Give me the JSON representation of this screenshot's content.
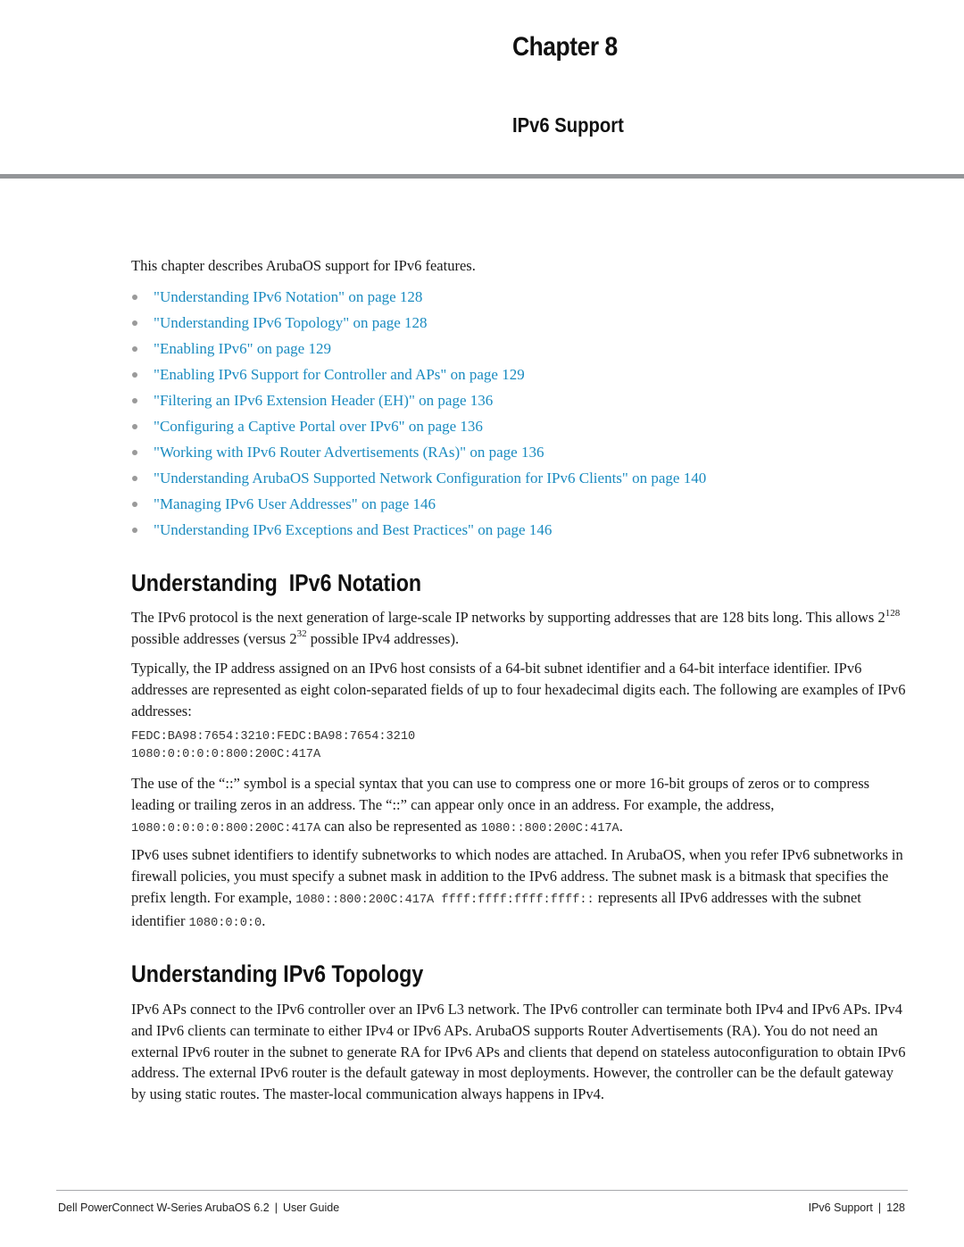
{
  "header": {
    "chapter_label": "Chapter 8",
    "chapter_title": "IPv6 Support"
  },
  "intro": "This chapter describes ArubaOS support for IPv6 features.",
  "toc": [
    {
      "label": "\"Understanding IPv6 Notation\" on page 128"
    },
    {
      "label": "\"Understanding IPv6 Topology\" on page 128"
    },
    {
      "label": "\"Enabling IPv6\" on page 129"
    },
    {
      "label": "\"Enabling IPv6 Support for Controller and APs\" on page 129"
    },
    {
      "label": "\"Filtering an IPv6 Extension Header (EH)\" on page 136"
    },
    {
      "label": "\"Configuring a Captive Portal over IPv6\" on page 136"
    },
    {
      "label": "\"Working with IPv6 Router Advertisements (RAs)\" on page 136"
    },
    {
      "label": "\"Understanding ArubaOS Supported Network Configuration for IPv6 Clients\" on page 140"
    },
    {
      "label": "\"Managing IPv6 User Addresses\" on page 146"
    },
    {
      "label": "\"Understanding IPv6 Exceptions and Best Practices\" on page 146"
    }
  ],
  "colors": {
    "link": "#1a8bc0",
    "bullet": "#9a9a9a",
    "rule": "#939598"
  },
  "notation": {
    "heading": "Understanding  IPv6 Notation",
    "p1": {
      "a": "The IPv6 protocol is the next generation of large-scale IP networks by supporting addresses that are 128 bits long. This allows 2",
      "sup1": "128",
      "b": " possible addresses (versus 2",
      "sup2": "32",
      "c": " possible IPv4 addresses)."
    },
    "p2": "Typically, the IP address assigned on an IPv6 host consists of a 64-bit subnet identifier and a 64-bit interface identifier. IPv6 addresses are represented as eight colon-separated fields of up to four hexadecimal digits each. The following are examples of IPv6 addresses:",
    "examples": [
      "FEDC:BA98:7654:3210:FEDC:BA98:7654:3210",
      "1080:0:0:0:0:800:200C:417A"
    ],
    "p3": {
      "a": "The use of the “::” symbol is a special syntax that you can use to compress one or more 16-bit groups of zeros or to compress leading or trailing zeros in an address. The “::” can appear only once in an address. For example, the address, ",
      "code1": "1080:0:0:0:0:800:200C:417A",
      "b": " can also be represented as ",
      "code2": "1080::800:200C:417A",
      "c": "."
    },
    "p4": {
      "a": "IPv6 uses subnet identifiers to identify subnetworks to which nodes are attached. In ArubaOS, when you refer IPv6 subnetworks in firewall policies, you must specify a subnet mask in addition to the IPv6 address. The subnet mask is a bitmask that specifies the prefix length. For example, ",
      "code1": "1080::800:200C:417A ffff:ffff:ffff:ffff::",
      "b": " represents all IPv6 addresses with the subnet identifier ",
      "code2": "1080:0:0:0",
      "c": "."
    }
  },
  "topology": {
    "heading": "Understanding IPv6 Topology",
    "p1": "IPv6 APs connect to the IPv6 controller over an IPv6 L3 network. The IPv6 controller can terminate both IPv4 and IPv6 APs. IPv4 and IPv6 clients can terminate to either IPv4 or IPv6 APs. ArubaOS supports Router Advertisements (RA). You do not need an external IPv6 router in the subnet to generate RA for IPv6 APs and clients that depend on stateless autoconfiguration to obtain IPv6 address. The external IPv6 router is the default gateway in most deployments. However, the controller can be the default gateway by using static routes. The master-local communication always happens in IPv4."
  },
  "footer": {
    "product": "Dell PowerConnect W-Series ArubaOS 6.2",
    "separator": "|",
    "guide": "User Guide",
    "section": "IPv6 Support",
    "page": "128"
  }
}
